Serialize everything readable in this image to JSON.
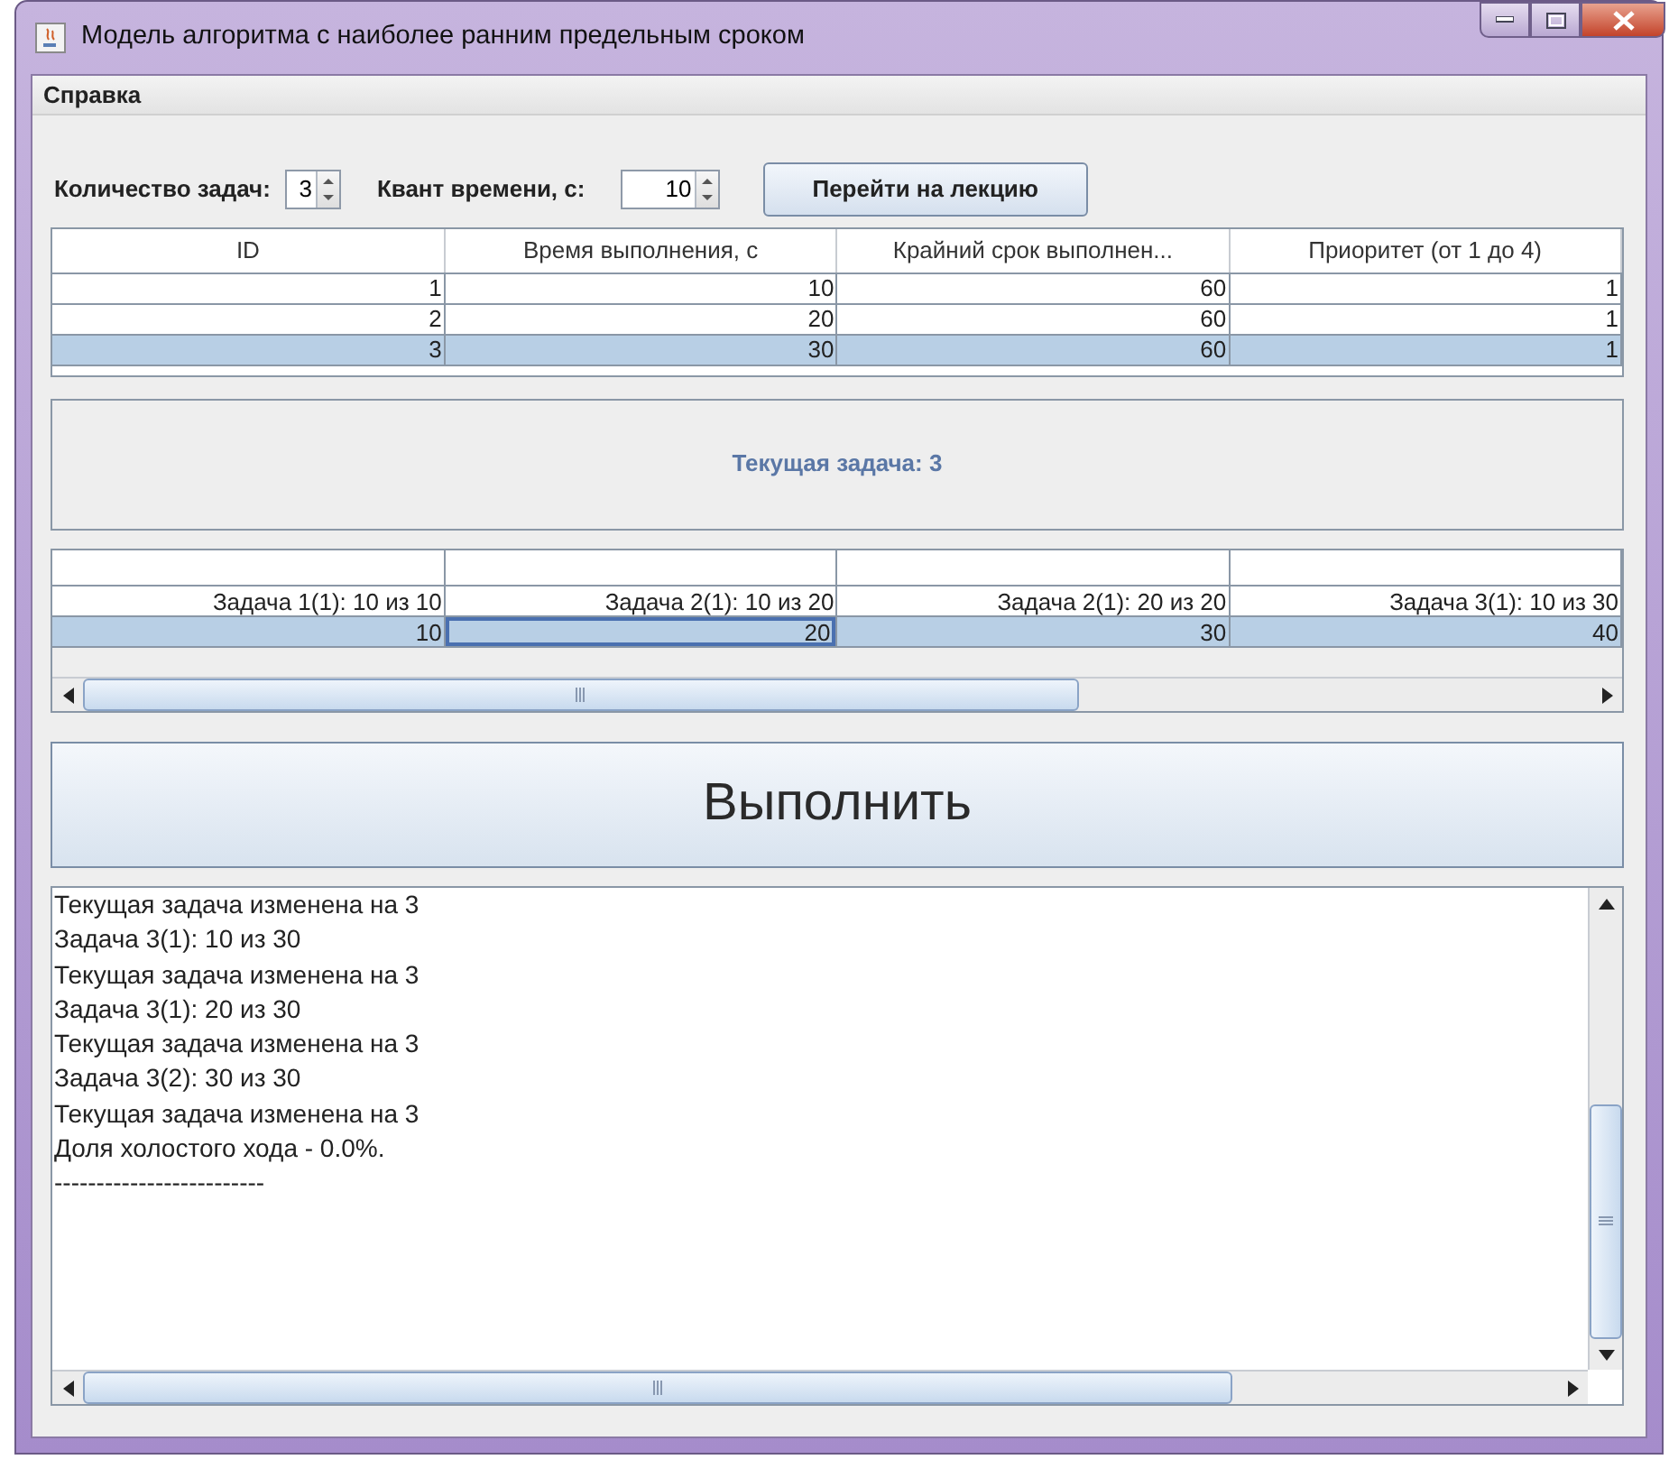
{
  "window": {
    "title": "Модель алгоритма с наиболее ранним предельным сроком"
  },
  "menu": [
    {
      "label": "Справка"
    }
  ],
  "controls": {
    "task_count": {
      "label": "Количество задач:",
      "value": "3"
    },
    "quantum": {
      "label": "Квант времени, с:",
      "value": "10"
    },
    "lecture_button": "Перейти на лекцию"
  },
  "tasks_table": {
    "columns": [
      "ID",
      "Время выполнения, с",
      "Крайний срок выполнен...",
      "Приоритет (от 1 до 4)"
    ],
    "rows": [
      {
        "cells": [
          "1",
          "10",
          "60",
          "1"
        ],
        "selected": false
      },
      {
        "cells": [
          "2",
          "20",
          "60",
          "1"
        ],
        "selected": false
      },
      {
        "cells": [
          "3",
          "30",
          "60",
          "1"
        ],
        "selected": true
      }
    ]
  },
  "current_task": "Текущая задача: 3",
  "timeline_table": {
    "rows": [
      {
        "selected": false,
        "cells": [
          {
            "text": "Задача 1(1): 10 из 10",
            "focused": false
          },
          {
            "text": "Задача 2(1): 10 из 20",
            "focused": false
          },
          {
            "text": "Задача 2(1): 20 из 20",
            "focused": false
          },
          {
            "text": "Задача 3(1): 10 из 30",
            "focused": false
          }
        ]
      },
      {
        "selected": true,
        "cells": [
          {
            "text": "10",
            "focused": false
          },
          {
            "text": "20",
            "focused": true
          },
          {
            "text": "30",
            "focused": false
          },
          {
            "text": "40",
            "focused": false
          }
        ]
      }
    ]
  },
  "execute_button": "Выполнить",
  "log": {
    "lines": [
      "Текущая задача изменена на 3",
      "Задача 3(1): 10 из 30",
      "Текущая задача изменена на 3",
      "Задача 3(1): 20 из 30",
      "Текущая задача изменена на 3",
      "Задача 3(2): 30 из 30",
      "Текущая задача изменена на 3",
      "Доля холостого хода - 0.0%.",
      "-------------------------"
    ]
  }
}
